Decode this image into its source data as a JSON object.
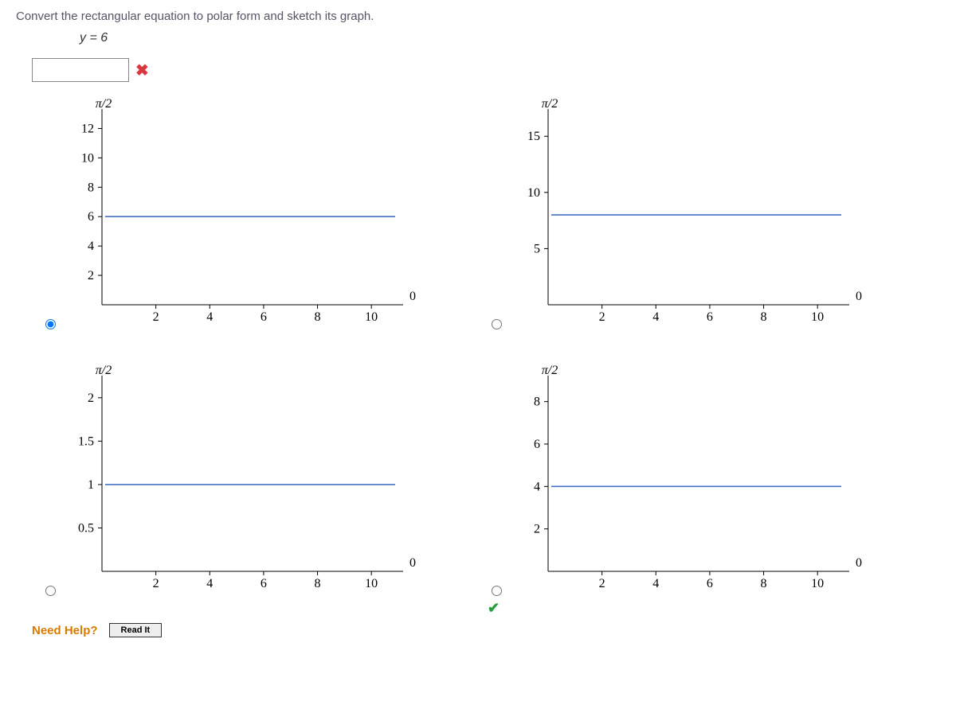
{
  "prompt": "Convert the rectangular equation to polar form and sketch its graph.",
  "equation": "y = 6",
  "answer_status": "incorrect",
  "need_help_label": "Need Help?",
  "read_it_label": "Read It",
  "axis_label_top": "π/2",
  "axis_label_right": "0",
  "chart_data": [
    {
      "type": "line",
      "xlabel": "0",
      "ylabel": "π/2",
      "xticks": [
        2,
        4,
        6,
        8,
        10
      ],
      "yticks": [
        2,
        4,
        6,
        8,
        10,
        12
      ],
      "xlim": [
        0,
        11
      ],
      "ylim": [
        0,
        13
      ],
      "line_y": 6,
      "selected": true
    },
    {
      "type": "line",
      "xlabel": "0",
      "ylabel": "π/2",
      "xticks": [
        2,
        4,
        6,
        8,
        10
      ],
      "yticks": [
        5,
        10,
        15
      ],
      "xlim": [
        0,
        11
      ],
      "ylim": [
        0,
        17
      ],
      "line_y": 8,
      "selected": false
    },
    {
      "type": "line",
      "xlabel": "0",
      "ylabel": "π/2",
      "xticks": [
        2,
        4,
        6,
        8,
        10
      ],
      "yticks": [
        0.5,
        1.0,
        1.5,
        2.0
      ],
      "xlim": [
        0,
        11
      ],
      "ylim": [
        0,
        2.2
      ],
      "line_y": 1.0,
      "selected": false
    },
    {
      "type": "line",
      "xlabel": "0",
      "ylabel": "π/2",
      "xticks": [
        2,
        4,
        6,
        8,
        10
      ],
      "yticks": [
        2,
        4,
        6,
        8
      ],
      "xlim": [
        0,
        11
      ],
      "ylim": [
        0,
        9
      ],
      "line_y": 4,
      "selected": false,
      "correct": true
    }
  ]
}
